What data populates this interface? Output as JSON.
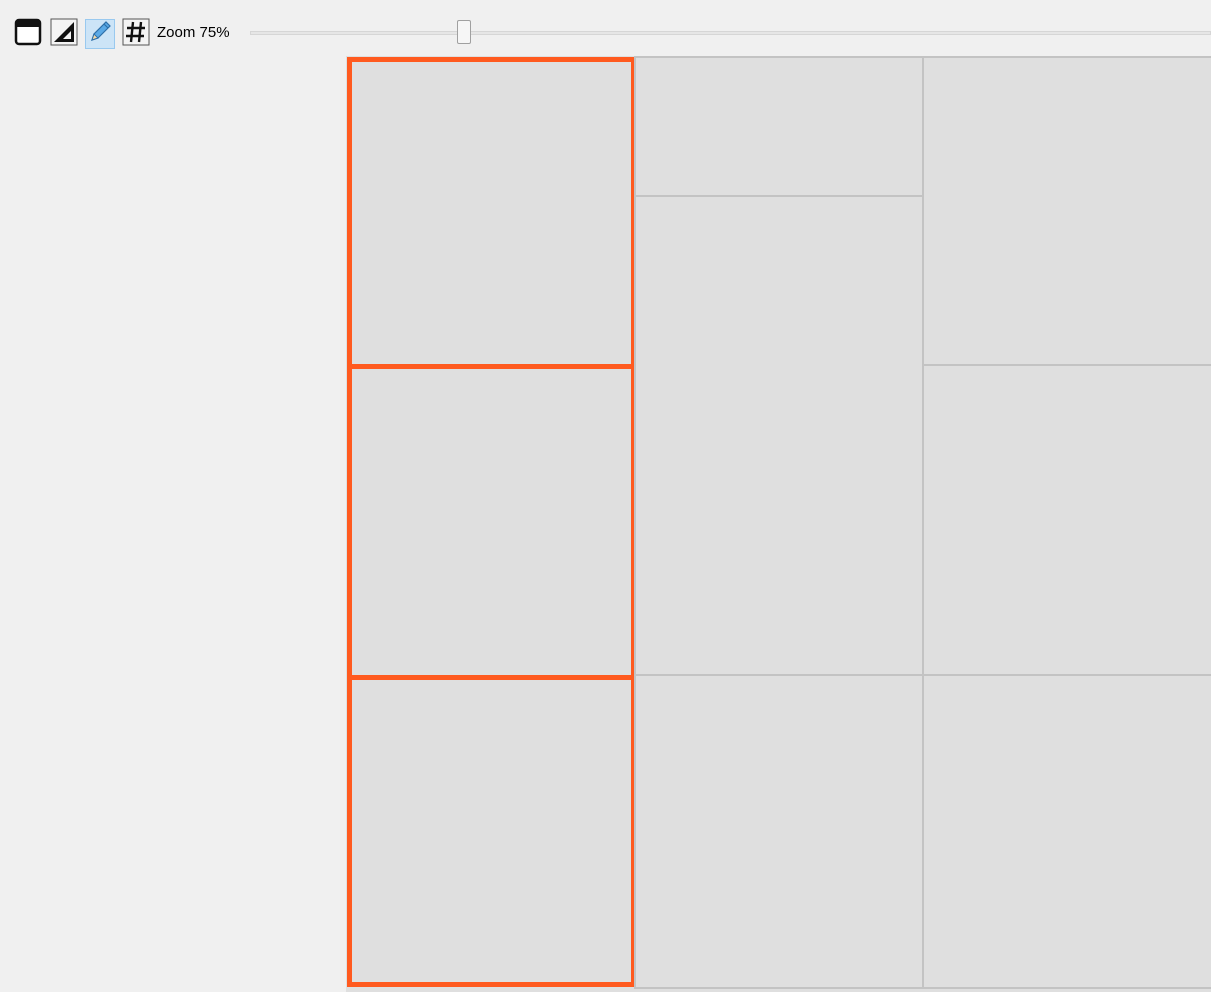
{
  "toolbar": {
    "buttons": [
      {
        "icon": "window-frame-icon",
        "active": false
      },
      {
        "icon": "triangle-ruler-icon",
        "active": false
      },
      {
        "icon": "pencil-icon",
        "active": true
      },
      {
        "icon": "grid-hash-icon",
        "active": false
      }
    ],
    "zoom_label": "Zoom 75%",
    "zoom_percent": 75
  },
  "canvas": {
    "selection_color": "#ff5a1f",
    "panel_border_color": "#c3c3c3",
    "panel_fill_color": "#dfdfdf",
    "accent_active": "#99c9ef"
  },
  "panels": [
    {
      "id": "col1-row1",
      "selected": true
    },
    {
      "id": "col1-row2",
      "selected": true
    },
    {
      "id": "col1-row3",
      "selected": true
    },
    {
      "id": "col2-row1",
      "selected": false
    },
    {
      "id": "col2-row2",
      "selected": false
    },
    {
      "id": "col2-row3",
      "selected": false
    },
    {
      "id": "col3-row1",
      "selected": false
    },
    {
      "id": "col3-row2",
      "selected": false
    },
    {
      "id": "col3-row3",
      "selected": false
    }
  ]
}
